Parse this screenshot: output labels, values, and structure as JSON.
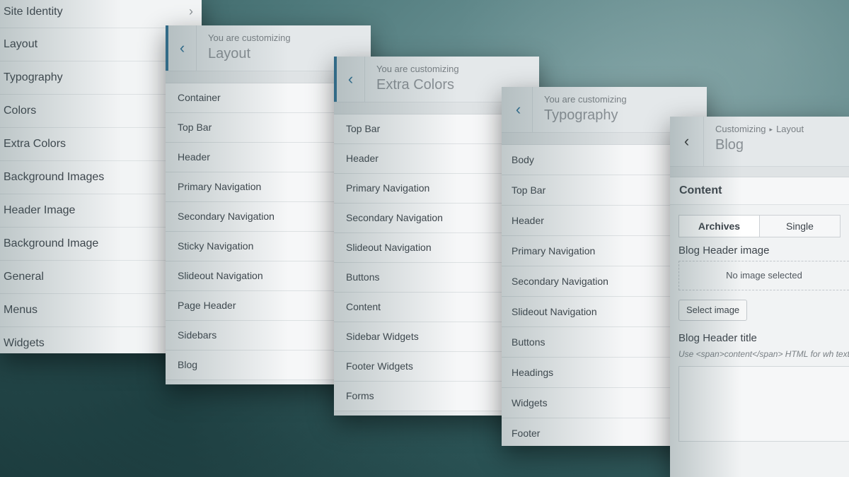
{
  "panel1": {
    "items": [
      "Site Identity",
      "Layout",
      "Typography",
      "Colors",
      "Extra Colors",
      "Background Images",
      "Header Image",
      "Background Image",
      "General",
      "Menus",
      "Widgets"
    ]
  },
  "panel2": {
    "subtitle": "You are customizing",
    "title": "Layout",
    "items": [
      "Container",
      "Top Bar",
      "Header",
      "Primary Navigation",
      "Secondary Navigation",
      "Sticky Navigation",
      "Slideout Navigation",
      "Page Header",
      "Sidebars",
      "Blog"
    ]
  },
  "panel3": {
    "subtitle": "You are customizing",
    "title": "Extra Colors",
    "items": [
      "Top Bar",
      "Header",
      "Primary Navigation",
      "Secondary Navigation",
      "Slideout Navigation",
      "Buttons",
      "Content",
      "Sidebar Widgets",
      "Footer Widgets",
      "Forms"
    ]
  },
  "panel4": {
    "subtitle": "You are customizing",
    "title": "Typography",
    "items": [
      "Body",
      "Top Bar",
      "Header",
      "Primary Navigation",
      "Secondary Navigation",
      "Slideout Navigation",
      "Buttons",
      "Headings",
      "Widgets",
      "Footer"
    ]
  },
  "panel5": {
    "breadcrumb_1": "Customizing",
    "breadcrumb_sep": "▸",
    "breadcrumb_2": "Layout",
    "title": "Blog",
    "section_title": "Content",
    "tab_archives": "Archives",
    "tab_single": "Single",
    "header_image_label": "Blog Header image",
    "no_image_text": "No image selected",
    "select_image_label": "Select image",
    "header_title_label": "Blog Header title",
    "help_text": "Use <span>content</span> HTML for wh text."
  },
  "colors": {
    "accent": "#2a6f97",
    "panel_bg": "#eef1f2",
    "text": "#3c434a"
  }
}
